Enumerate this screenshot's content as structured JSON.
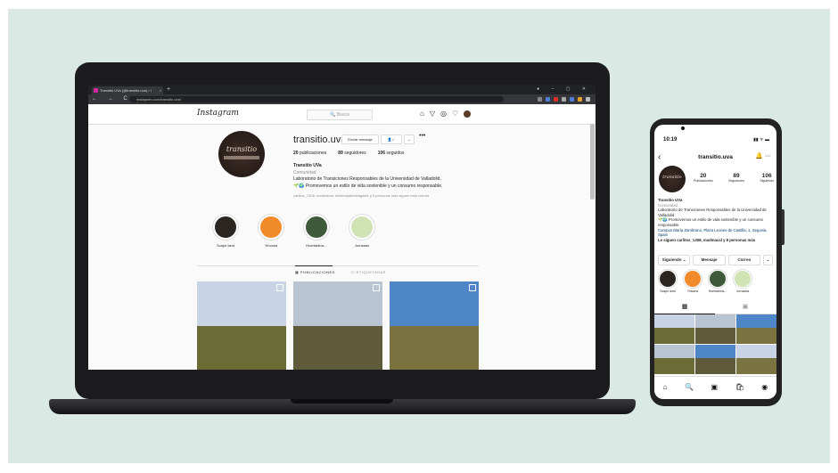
{
  "browser": {
    "tab_title": "Transitio UVa (@transitio.uva) • I",
    "tab_close": "×",
    "new_tab": "+",
    "window_controls": "● – ▢ ✕",
    "nav_buttons": "← → C ⌂",
    "url": "instagram.com/transitio.uva/"
  },
  "header": {
    "logo": "Instagram",
    "search_placeholder": "🔍 Busca",
    "icons": [
      "home-icon",
      "direct-icon",
      "explore-icon",
      "heart-icon",
      "avatar"
    ],
    "icon_glyphs": [
      "⌂",
      "▽",
      "◎",
      "♡"
    ]
  },
  "profile": {
    "avatar_text": "transitio",
    "username": "transitio.uva",
    "message_button": "Enviar mensaje",
    "follow_button": "👤✓",
    "suggest_button": "⌄",
    "more": "•••",
    "posts_count": "20",
    "posts_label": "publicaciones",
    "followers_count": "89",
    "followers_label": "seguidores",
    "following_count": "106",
    "following_label": "seguidos",
    "name": "Transitio UVa",
    "category": "Comunidad",
    "bio_line1": "Laboratorio de Transiciones Responsables de la Universidad de Valladolid.",
    "bio_line2": "🌱🌍 Promovemos un estilo de vida sostenible y un consumo responsable.",
    "followed_by": "carlitos_1308, madmacal, alimentadesdeagaste y 9 personas más siguen esta cuenta"
  },
  "highlights": [
    {
      "label": "Scape land",
      "color": "#2b2622"
    },
    {
      "label": "Yincana",
      "color": "#f08a2a"
    },
    {
      "label": "Huertabilos...",
      "color": "#3e5a3a"
    },
    {
      "label": "Jornadas",
      "color": "#cfe3b4"
    }
  ],
  "post_tabs": {
    "posts": "▦ PUBLICACIONES",
    "tagged": "☐ ETIQUETADAS"
  },
  "posts": [
    {
      "sky": "#c8d4e6",
      "ground": "#6a6b35"
    },
    {
      "sky": "#b8c4d2",
      "ground": "#5e5a3a"
    },
    {
      "sky": "#4e86c8",
      "ground": "#7a7340"
    }
  ],
  "mobile": {
    "time": "10:19",
    "status_icons": "▮▮ ᯤ ▬",
    "back": "‹",
    "username": "transitio.uva",
    "header_icons": "🔔 ···",
    "avatar_text": "transitio",
    "posts_count": "20",
    "posts_label": "Publicaciones",
    "followers_count": "89",
    "followers_label": "Seguidores",
    "following_count": "106",
    "following_label": "Siguiendo",
    "name": "Transitio UVa",
    "category": "Comunidad",
    "bio": "Laboratorio de Transiciones Responsables de la Universidad de Valladolid.",
    "bio2": "🌱🌍 Promovemos un estilo de vida sostenible y un consumo responsable.",
    "address": "Campus María Zambrano, Plaza Leones de Castilla, 1, Segovia, Spain",
    "followed_by": "Le siguen carlitos_1308, madmacal y 8 personas más",
    "following_button": "Siguiendo ⌄",
    "message_button": "Mensaje",
    "email_button": "Correo",
    "more_button": "⌄",
    "highlights": [
      "Scape land",
      "Yincana",
      "Huertabilos...",
      "Jornadas"
    ],
    "grid_tab": "▦",
    "tagged_tab": "▣",
    "nav_icons": [
      "⌂",
      "🔍",
      "▣",
      "🛍",
      "◉"
    ]
  }
}
